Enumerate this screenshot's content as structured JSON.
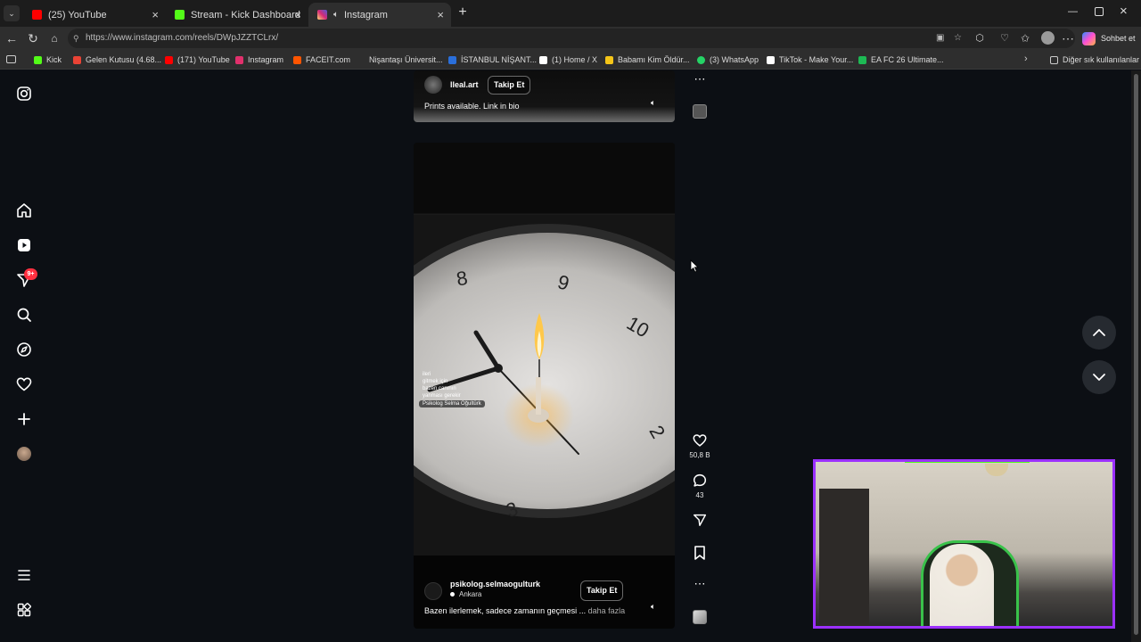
{
  "browser": {
    "tabs": [
      {
        "title": "(25) YouTube",
        "favicon_color": "#ff0000",
        "active": false
      },
      {
        "title": "Stream - Kick Dashboard",
        "favicon_color": "#53fc18",
        "active": false
      },
      {
        "title": "Instagram",
        "favicon_color": "#e1306c",
        "active": true
      }
    ],
    "new_tab_glyph": "+",
    "address": "https://www.instagram.com/reels/DWpJZZTCLrx/",
    "copilot_label": "Sohbet et",
    "bookmarks": [
      {
        "label": "Kick",
        "color": "#53fc18"
      },
      {
        "label": "Gelen Kutusu (4.68...",
        "color": "#ea4335"
      },
      {
        "label": "(171) YouTube",
        "color": "#ff0000"
      },
      {
        "label": "Instagram",
        "color": "#e1306c"
      },
      {
        "label": "FACEIT.com",
        "color": "#ff5500"
      },
      {
        "label": "Nişantaşı Üniversit...",
        "color": "#2e2e2e"
      },
      {
        "label": "İSTANBUL NİŞANT...",
        "color": "#2a6fdb"
      },
      {
        "label": "(1) Home / X",
        "color": "#ffffff"
      },
      {
        "label": "Babamı Kim Öldür...",
        "color": "#f5c518"
      },
      {
        "label": "(3) WhatsApp",
        "color": "#25d366"
      },
      {
        "label": "TikTok - Make Your...",
        "color": "#ffffff"
      },
      {
        "label": "EA FC 26 Ultimate...",
        "color": "#1db954"
      }
    ],
    "other_bookmarks": "Diğer sık kullanılanlar"
  },
  "sidebar": {
    "icons": [
      "instagram-logo-icon",
      "home-icon",
      "reels-icon",
      "messages-icon",
      "search-icon",
      "explore-icon",
      "notifications-icon",
      "create-icon",
      "profile-avatar",
      "menu-icon",
      "more-apps-icon"
    ],
    "messages_badge": "9+"
  },
  "reel_top": {
    "username": "lleal.art",
    "follow_label": "Takip Et",
    "caption": "Prints available. Link in bio"
  },
  "reel_main": {
    "overlay_lines": [
      "ileri",
      "gitmek için",
      "bazen canının",
      "yanması gerekir"
    ],
    "overlay_tag": "Psikolog Selma Oğultürk",
    "clock_numbers": [
      "8",
      "9",
      "10",
      "2",
      "3"
    ],
    "username": "psikolog.selmaogulturk",
    "location": "Ankara",
    "follow_label": "Takip Et",
    "caption": "Bazen ilerlemek, sadece zamanın geçmesi ...",
    "more_label": "daha fazla"
  },
  "actions": {
    "likes": "50,8 B",
    "comments": "43"
  },
  "colors": {
    "accent_badge": "#ff3040",
    "page_bg": "#0c0f14",
    "webcam_border": "#9b30ff",
    "webcam_border_2": "#53fc18"
  }
}
